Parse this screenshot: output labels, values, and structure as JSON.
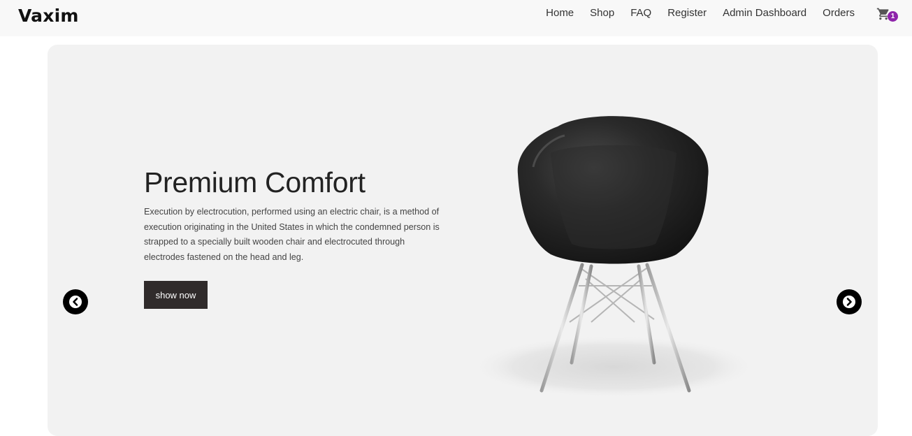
{
  "navbar": {
    "brand": "Vaxim",
    "links": [
      "Home",
      "Shop",
      "FAQ",
      "Register",
      "Admin Dashboard",
      "Orders"
    ],
    "cart_count": "1",
    "cart_icon": "shopping-cart-icon",
    "badge_color": "#8e24aa"
  },
  "hero": {
    "title": "Premium Comfort",
    "description": "Execution by electrocution, performed using an electric chair, is a method of execution originating in the United States in which the condemned person is strapped to a specially built wooden chair and electrocuted through electrodes fastened on the head and leg.",
    "button_label": "show now",
    "button_color": "#302b2b",
    "background": "#f2f2f2",
    "prev_icon": "chevron-left-icon",
    "next_icon": "chevron-right-icon"
  }
}
